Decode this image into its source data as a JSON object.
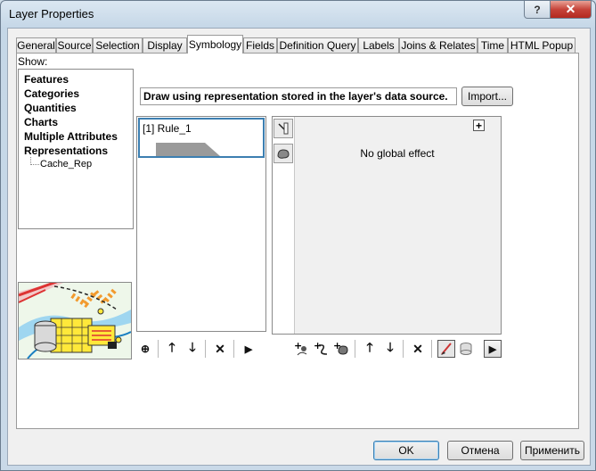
{
  "window": {
    "title": "Layer Properties",
    "help_glyph": "?",
    "close_glyph": "✕"
  },
  "tabs": [
    {
      "label": "General",
      "active": false
    },
    {
      "label": "Source",
      "active": false
    },
    {
      "label": "Selection",
      "active": false
    },
    {
      "label": "Display",
      "active": false
    },
    {
      "label": "Symbology",
      "active": true
    },
    {
      "label": "Fields",
      "active": false
    },
    {
      "label": "Definition Query",
      "active": false
    },
    {
      "label": "Labels",
      "active": false
    },
    {
      "label": "Joins & Relates",
      "active": false
    },
    {
      "label": "Time",
      "active": false
    },
    {
      "label": "HTML Popup",
      "active": false
    }
  ],
  "show": {
    "label": "Show:",
    "items": [
      "Features",
      "Categories",
      "Quantities",
      "Charts",
      "Multiple Attributes",
      "Representations"
    ],
    "sub_item": "Cache_Rep",
    "selected": "Cache_Rep"
  },
  "description": "Draw using representation stored in the layer's data source.",
  "import_label": "Import...",
  "rules": [
    {
      "label": "[1] Rule_1"
    }
  ],
  "effect": {
    "text": "No global effect",
    "add_glyph": "+"
  },
  "toolbars": {
    "rules": {
      "add": "⊕",
      "up": "🡑",
      "down": "🡓",
      "remove": "✕",
      "more": "▶"
    },
    "effects": {
      "up": "🡑",
      "down": "🡓",
      "remove": "✕",
      "more": "▶"
    }
  },
  "buttons": {
    "ok": "OK",
    "cancel": "Отмена",
    "apply": "Применить"
  },
  "colors": {
    "selection_border": "#3c7fb1",
    "close_red": "#c6443a"
  }
}
